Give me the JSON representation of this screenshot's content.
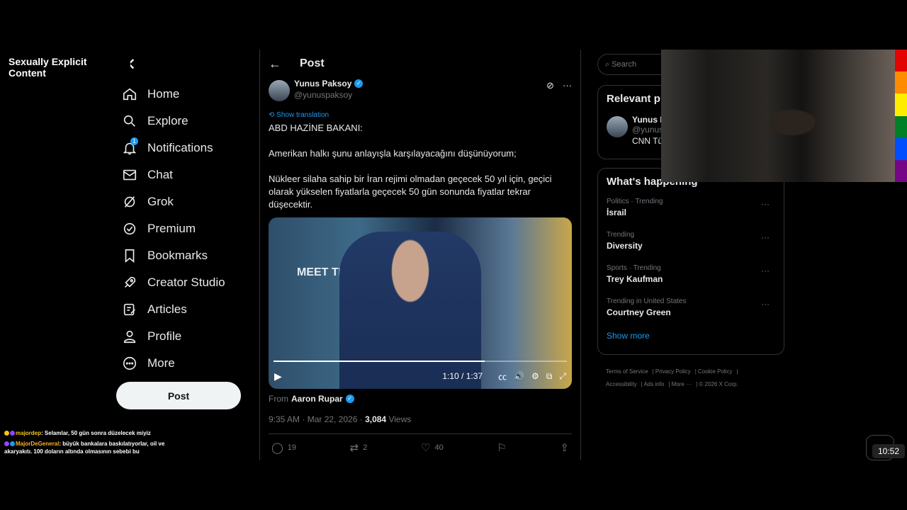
{
  "overlay": {
    "label": "Sexually Explicit Content"
  },
  "nav": {
    "items": [
      {
        "label": "Home"
      },
      {
        "label": "Explore"
      },
      {
        "label": "Notifications",
        "badge": "1"
      },
      {
        "label": "Chat"
      },
      {
        "label": "Grok"
      },
      {
        "label": "Premium"
      },
      {
        "label": "Bookmarks"
      },
      {
        "label": "Creator Studio"
      },
      {
        "label": "Articles"
      },
      {
        "label": "Profile"
      },
      {
        "label": "More"
      }
    ],
    "post_button": "Post"
  },
  "chat": {
    "messages": [
      {
        "user": "majordep",
        "text": "Selamlar, 50 gün sonra düzelecek miyiz"
      },
      {
        "user": "MajorDeGeneral",
        "text": "büyük bankalara baskılatıyorlar, oil ve akaryakıtı. 100 doların altında olmasının sebebi bu"
      }
    ]
  },
  "main": {
    "title": "Post",
    "author": {
      "name": "Yunus Paksoy",
      "handle": "@yunuspaksoy"
    },
    "show_translation": "Show translation",
    "text": [
      "ABD HAZİNE BAKANI:",
      "Amerikan halkı şunu anlayışla karşılayacağını düşünüyorum;",
      "Nükleer silaha sahip bir İran rejimi olmadan geçecek 50 yıl için, geçici olarak yükselen fiyatlarla geçecek 50 gün sonunda fiyatlar tekrar düşecektir."
    ],
    "video": {
      "time": "1:10 / 1:37",
      "progress": 0.72,
      "logo_text": "MEET THE PRESS"
    },
    "from_label": "From",
    "from_user": "Aaron Rupar",
    "timestamp": "9:35 AM · Mar 22, 2026 · ",
    "views_count": "3,084",
    "views_label": " Views",
    "replies": "19",
    "reposts": "2",
    "likes": "40"
  },
  "right": {
    "search_placeholder": "Search",
    "relevant_title": "Relevant p",
    "relevant_user": {
      "name": "Yunus P",
      "handle": "@yunus",
      "bio": "CNN Tü"
    },
    "happening_title": "What's happening",
    "trends": [
      {
        "context": "Politics · Trending",
        "name": "İsrail"
      },
      {
        "context": "Trending",
        "name": "Diversity"
      },
      {
        "context": "Sports · Trending",
        "name": "Trey Kaufman"
      },
      {
        "context": "Trending in United States",
        "name": "Courtney Green"
      }
    ],
    "show_more": "Show more",
    "footer": [
      "Terms of Service",
      "Privacy Policy",
      "Cookie Policy",
      "Accessibility",
      "Ads info",
      "More ···",
      "© 2026 X Corp."
    ]
  },
  "clock": "10:52",
  "colors": {
    "accent": "#1d9bf0",
    "rainbow": [
      "#e40303",
      "#ff8c00",
      "#ffed00",
      "#008026",
      "#004dff",
      "#750787"
    ]
  }
}
